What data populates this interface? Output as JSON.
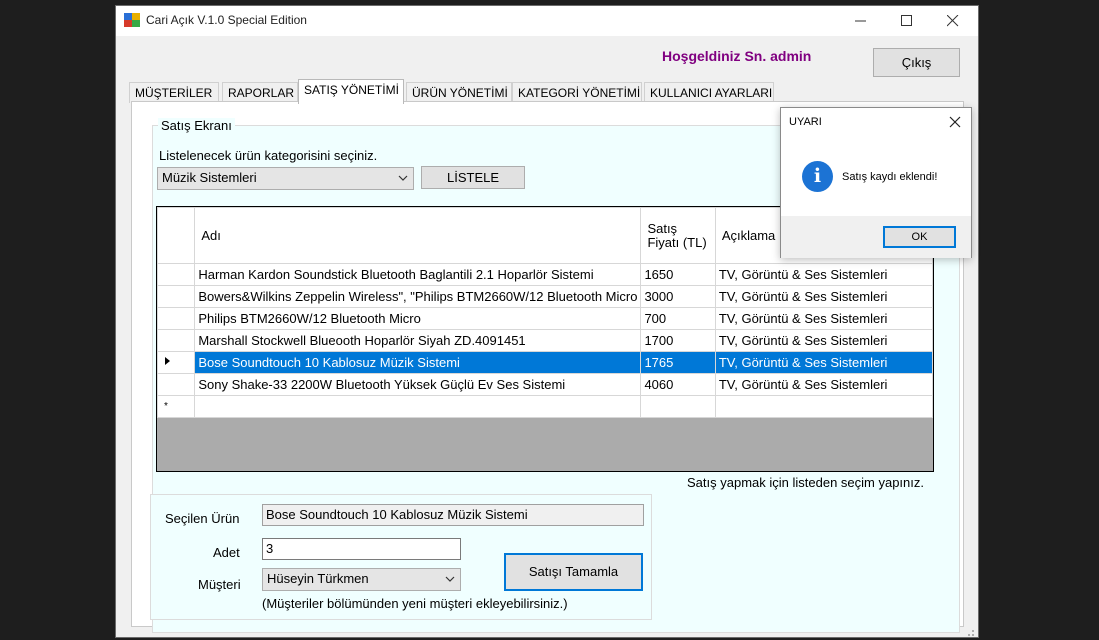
{
  "window": {
    "title": "Cari Açık V.1.0 Special Edition"
  },
  "header": {
    "welcome": "Hoşgeldiniz Sn. admin",
    "exit_label": "Çıkış"
  },
  "tabs": [
    {
      "label": "MÜŞTERİLER"
    },
    {
      "label": "RAPORLAR"
    },
    {
      "label": "SATIŞ YÖNETİMİ",
      "active": true
    },
    {
      "label": "ÜRÜN YÖNETİMİ"
    },
    {
      "label": "KATEGORİ YÖNETİMİ"
    },
    {
      "label": "KULLANICI AYARLARI"
    }
  ],
  "sales": {
    "group_title": "Satış Ekranı",
    "category_prompt": "Listelenecek ürün kategorisini seçiniz.",
    "category_selected": "Müzik Sistemleri",
    "list_button": "LİSTELE",
    "grid": {
      "columns": [
        "Adı",
        "Satış Fiyatı (TL)",
        "Açıklama"
      ],
      "rows": [
        [
          "Harman Kardon Soundstick Bluetooth Baglantili 2.1 Hoparlör Sistemi",
          "1650",
          "TV, Görüntü & Ses Sistemleri"
        ],
        [
          "Bowers&Wilkins Zeppelin Wireless\", \"Philips BTM2660W/12 Bluetooth Micro",
          "3000",
          "TV, Görüntü & Ses Sistemleri"
        ],
        [
          "Philips BTM2660W/12 Bluetooth Micro",
          "700",
          "TV, Görüntü & Ses Sistemleri"
        ],
        [
          "Marshall Stockwell Blueooth Hoparlör Siyah ZD.4091451",
          "1700",
          "TV, Görüntü & Ses Sistemleri"
        ],
        [
          "Bose Soundtouch 10 Kablosuz Müzik Sistemi",
          "1765",
          "TV, Görüntü & Ses Sistemleri"
        ],
        [
          "Sony Shake-33 2200W Bluetooth Yüksek Güçlü Ev Ses Sistemi",
          "4060",
          "TV, Görüntü & Ses Sistemleri"
        ]
      ],
      "selected_row_index": 4,
      "new_row_marker": "*"
    },
    "selection_hint": "Satış yapmak için listeden seçim yapınız."
  },
  "selection": {
    "product_label": "Seçilen Ürün",
    "product_value": "Bose Soundtouch 10 Kablosuz Müzik Sistemi",
    "quantity_label": "Adet",
    "quantity_value": "3",
    "customer_label": "Müşteri",
    "customer_value": "Hüseyin Türkmen",
    "customer_note": "(Müşteriler bölümünden yeni müşteri ekleyebilirsiniz.)",
    "complete_button": "Satışı Tamamla"
  },
  "dialog": {
    "title": "UYARI",
    "message": "Satış kaydı eklendi!",
    "ok_label": "OK",
    "icon": "info-icon"
  },
  "colors": {
    "accent": "#0078d7",
    "welcome_text": "#800080",
    "panel_background": "#f0ffff",
    "info_icon": "#1c73d4"
  }
}
